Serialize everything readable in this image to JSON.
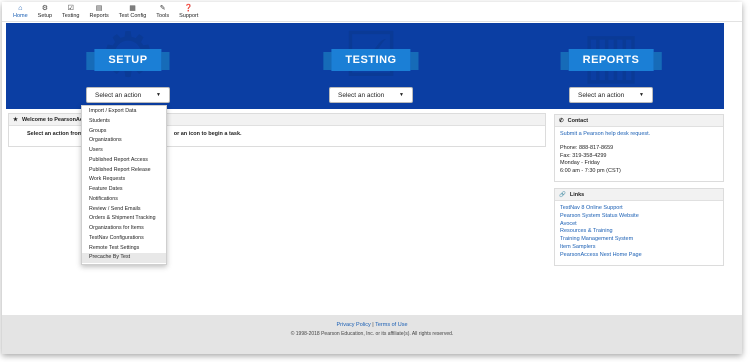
{
  "nav": [
    {
      "label": "Home",
      "icon": "home-icon",
      "glyph": "⌂"
    },
    {
      "label": "Setup",
      "icon": "gear-icon",
      "glyph": "⚙"
    },
    {
      "label": "Testing",
      "icon": "checkbox-icon",
      "glyph": "☑"
    },
    {
      "label": "Reports",
      "icon": "chart-icon",
      "glyph": "▤"
    },
    {
      "label": "Test Config",
      "icon": "config-icon",
      "glyph": "▦"
    },
    {
      "label": "Tools",
      "icon": "wrench-icon",
      "glyph": "✎"
    },
    {
      "label": "Support",
      "icon": "question-icon",
      "glyph": "❓"
    }
  ],
  "hero": {
    "setup": {
      "title": "SETUP",
      "select": "Select an action"
    },
    "testing": {
      "title": "TESTING",
      "select": "Select an action"
    },
    "reports": {
      "title": "REPORTS",
      "select": "Select an action"
    }
  },
  "welcome": {
    "title": "Welcome to PearsonAcc",
    "body_start": "Select an action from",
    "body_end": "or an icon to begin a task."
  },
  "setup_menu": [
    "Import / Export Data",
    "Students",
    "Groups",
    "Organizations",
    "Users",
    "Published Report Access",
    "Published Report Release",
    "Work Requests",
    "Feature Dates",
    "Notifications",
    "Review / Send Emails",
    "Orders & Shipment Tracking",
    "Organizations for Items",
    "TestNav Configurations",
    "Remote Test Settings",
    "Precache By Test"
  ],
  "contact": {
    "title": "Contact",
    "help_link": "Submit a Pearson help desk request.",
    "phone": "Phone: 888-817-8659",
    "fax": "Fax: 319-358-4299",
    "days": "Monday - Friday",
    "hours": "6:00 am - 7:30 pm (CST)"
  },
  "links": {
    "title": "Links",
    "items": [
      "TestNav 8 Online Support",
      "Pearson System Status Website",
      "Avocet",
      "Resources & Training",
      "Training Management System",
      "Item Samplers",
      "PearsonAccess Next Home Page"
    ]
  },
  "footer": {
    "privacy": "Privacy Policy",
    "separator": "|",
    "terms": "Terms of Use",
    "copyright": "© 1998-2018 Pearson Education, Inc. or its affiliate(s). All rights reserved."
  },
  "colors": {
    "hero_bg": "#0b3ea3",
    "ribbon": "#1b7fd6",
    "link": "#1a5fb4"
  }
}
